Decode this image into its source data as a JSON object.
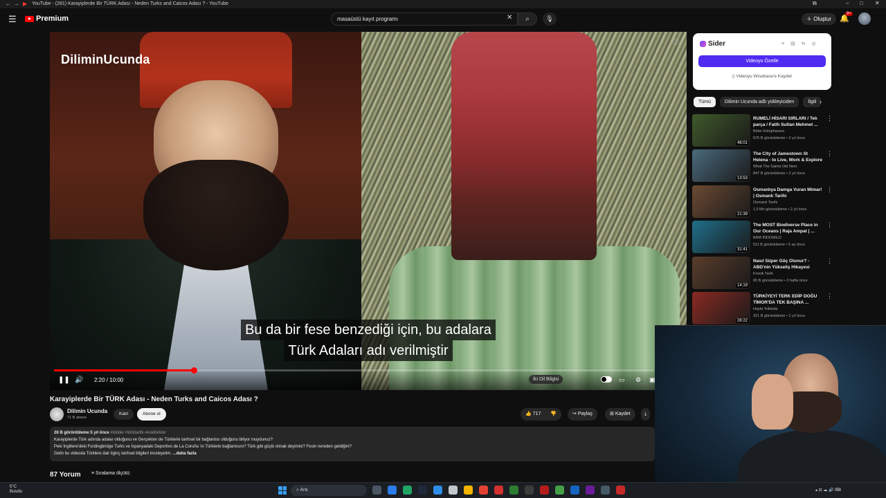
{
  "browser": {
    "tab_title": "YouTube - (281) Karayiplerde Bir TÜRK Adası - Neden Turks and Caicos Adası ? - YouTube"
  },
  "header": {
    "logo_text": "Premium",
    "search_value": "masaüstü kayıt programı",
    "create_label": "Oluştur",
    "notifications_badge": "9+"
  },
  "player": {
    "watermark": "DiliminUcunda",
    "subtitle_line1": "Bu da bir fese benzediği için, bu adalara",
    "subtitle_line2": "Türk Adaları adı verilmiştir",
    "time_display": "2:20 / 10:00",
    "progress_fraction": 0.233,
    "lang_pill": "İki Dil Bilgisi"
  },
  "video": {
    "title": "Karayiplerde Bir TÜRK Adası - Neden Turks and Caicos Adası ?",
    "channel_name": "Dilimin Ucunda",
    "channel_subs": "71 B abone",
    "join_label": "Katıl",
    "subscribe_label": "Abone ol",
    "like_count": "717",
    "share_label": "Paylaş",
    "save_label": "Kaydet"
  },
  "description": {
    "meta": "28 B görüntüleme  5 yıl önce",
    "tags": "#türkler #türktarihi #eskitürkler",
    "line1": "Karayiplerde Türk adında adalar olduğunu ve Gerçekten de Türklerle tarihsel bir bağlantısı olduğunu biliyor muydunuz?",
    "line2": "Peki İngiltere'deki Fordingbridge Turks ve İspanyadaki Deportivo de La Coruña 'ın Türklerle bağlantısını? Türk gibi güçlü olmak deyimini? Fesin nereden geldiğini?",
    "line3": "Gelin bu videoda Türklere dair ilginç tarihsel bilgileri inceleyelim.",
    "more": "...daha fazla"
  },
  "comments": {
    "count": "87 Yorum",
    "sort_label": "Sıralama ölçütü:"
  },
  "sider": {
    "name": "Sider",
    "summarize_label": "Videoyu Özetle",
    "save_label": "Videoyu Wisebase'e Kaydet"
  },
  "chips": [
    "Tümü",
    "Dilimin Ucunda adlı yükleyiciden",
    "İlgili"
  ],
  "recommendations": [
    {
      "title": "RUMELİ HİSARI SIRLARI / Tek parça / Fatih Sultan Mehmet ...",
      "channel": "Birler Kütüphanesi",
      "meta": "576 B görüntüleme • 2 yıl önce",
      "duration": "46:01",
      "thumb_color": "#3f5a2a"
    },
    {
      "title": "The City of Jamestown St Helena - to Live, Work & Explore",
      "channel": "What The Saints Did Next",
      "meta": "847 B görüntüleme • 2 yıl önce",
      "duration": "13:53",
      "thumb_color": "#4b6a7d"
    },
    {
      "title": "Osmanlıya Damga Vuran Mimar! | Osmanlı Tarihi",
      "channel": "Osmanlı Tarihi",
      "meta": "1,5 Mn görüntüleme • 2 yıl önce",
      "duration": "21:39",
      "thumb_color": "#6b4a32"
    },
    {
      "title": "The MOST Biodiverse Place in Our Oceans | Raja Ampat | ...",
      "channel": "BAM INDOWILD",
      "meta": "511 B görüntüleme • 5 ay önce",
      "duration": "31:41",
      "thumb_color": "#1f6f8b"
    },
    {
      "title": "Nasıl Süper Güç Olunur? - ABD'nin Yükseliş Hikayesi",
      "channel": "Kronik Tarih",
      "meta": "65 B görüntüleme • 3 hafta önce",
      "duration": "14:19",
      "thumb_color": "#5a3d2b"
    },
    {
      "title": "TÜRKİYEYİ TERK EDİP DOĞU TİMOR'DA TEK BAŞINA ...",
      "channel": "Hayta Yollarda",
      "meta": "321 B görüntüleme • 1 yıl önce",
      "duration": "26:22",
      "thumb_color": "#8b2a22"
    }
  ],
  "taskbar": {
    "weather_temp": "5°C",
    "weather_text": "Bulutlu",
    "search_label": "Ara"
  }
}
